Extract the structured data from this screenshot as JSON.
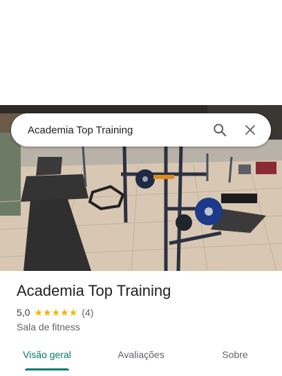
{
  "search": {
    "query": "Academia Top Training",
    "search_icon": "search-icon",
    "close_icon": "close-icon"
  },
  "place": {
    "name": "Academia Top Training",
    "rating": "5,0",
    "stars": 5,
    "review_count": "(4)",
    "category": "Sala de fitness",
    "photo": "gym-interior-photo"
  },
  "tabs": [
    {
      "label": "Visão geral",
      "active": true
    },
    {
      "label": "Avaliações",
      "active": false
    },
    {
      "label": "Sobre",
      "active": false
    }
  ],
  "colors": {
    "accent": "#00796b",
    "star": "#f4b400"
  }
}
